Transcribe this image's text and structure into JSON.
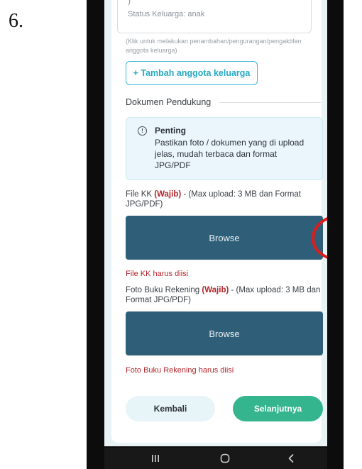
{
  "step_number": "6.",
  "family_member": {
    "chevron": ")",
    "status": "Status Keluarga: anak"
  },
  "hint": "(Klik untuk melakukan penambahan/pengurangan/pengaktifan anggota keluarga)",
  "add_member_button": "+ Tambah anggota keluarga",
  "section_title": "Dokumen Pendukung",
  "info": {
    "title": "Penting",
    "text": "Pastikan foto / dokumen yang di upload jelas, mudah terbaca dan format JPG/PDF"
  },
  "upload_kk": {
    "label_prefix": "File KK",
    "required": "(Wajib)",
    "label_suffix": " - (Max upload: 3 MB dan Format JPG/PDF)",
    "browse_label": "Browse",
    "error": "File KK harus diisi"
  },
  "upload_bank": {
    "label_prefix": "Foto Buku Rekening",
    "required": "(Wajib)",
    "label_suffix": " - (Max upload: 3 MB dan Format JPG/PDF)",
    "browse_label": "Browse",
    "error": "Foto Buku Rekening harus diisi"
  },
  "buttons": {
    "back": "Kembali",
    "next": "Selanjutnya"
  },
  "colors": {
    "primary_dark": "#2f5f78",
    "accent_cyan": "#25a9c2",
    "success_green": "#34b58d",
    "error_red": "#b3262c",
    "annotation_red": "#e01b1b"
  },
  "icons": {
    "info": "info-circle-icon",
    "nav_recent": "recent-apps-icon",
    "nav_home": "home-icon",
    "nav_back": "back-icon"
  }
}
